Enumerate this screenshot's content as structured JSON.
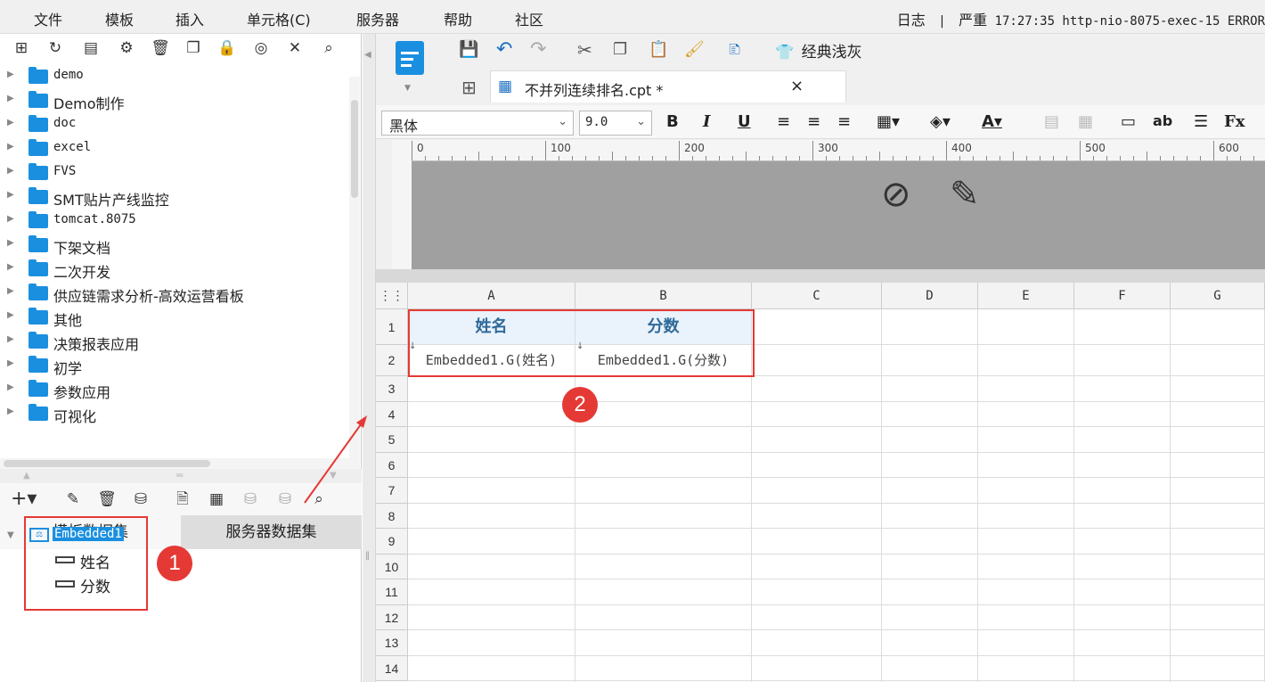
{
  "menu": [
    "文件",
    "模板",
    "插入",
    "单元格(C)",
    "服务器",
    "帮助",
    "社区"
  ],
  "log": {
    "label": "日志",
    "sep": "|",
    "level": "严重",
    "text": "17:27:35 http-nio-8075-exec-15 ERROR"
  },
  "tree": [
    "demo",
    "Demo制作",
    "doc",
    "excel",
    "FVS",
    "SMT贴片产线监控",
    "tomcat.8075",
    "下架文档",
    "二次开发",
    "供应链需求分析-高效运营看板",
    "其他",
    "决策报表应用",
    "初学",
    "参数应用",
    "可视化"
  ],
  "dataset_tabs": {
    "template": "模板数据集",
    "server": "服务器数据集"
  },
  "dataset": {
    "name": "Embedded1",
    "fields": [
      "姓名",
      "分数"
    ]
  },
  "toolbar": {
    "style_label": "经典浅灰"
  },
  "file_tab": {
    "title": "不并列连续排名.cpt *",
    "close": "×"
  },
  "format": {
    "font": "黑体",
    "size": "9.0"
  },
  "ruler": [
    "0",
    "100",
    "200",
    "300",
    "400",
    "500",
    "600"
  ],
  "columns": [
    "A",
    "B",
    "C",
    "D",
    "E",
    "F",
    "G"
  ],
  "rows": [
    "1",
    "2",
    "3",
    "4",
    "5",
    "6",
    "7",
    "8",
    "9",
    "10",
    "11",
    "12",
    "13",
    "14"
  ],
  "cells": {
    "A1": "姓名",
    "B1": "分数",
    "A2": "Embedded1.G(姓名)",
    "B2": "Embedded1.G(分数)"
  },
  "badges": [
    "1",
    "2"
  ],
  "colors": {
    "accent": "#1a8fe0",
    "annotation": "#e53935",
    "header_fill": "#eaf2fb"
  }
}
